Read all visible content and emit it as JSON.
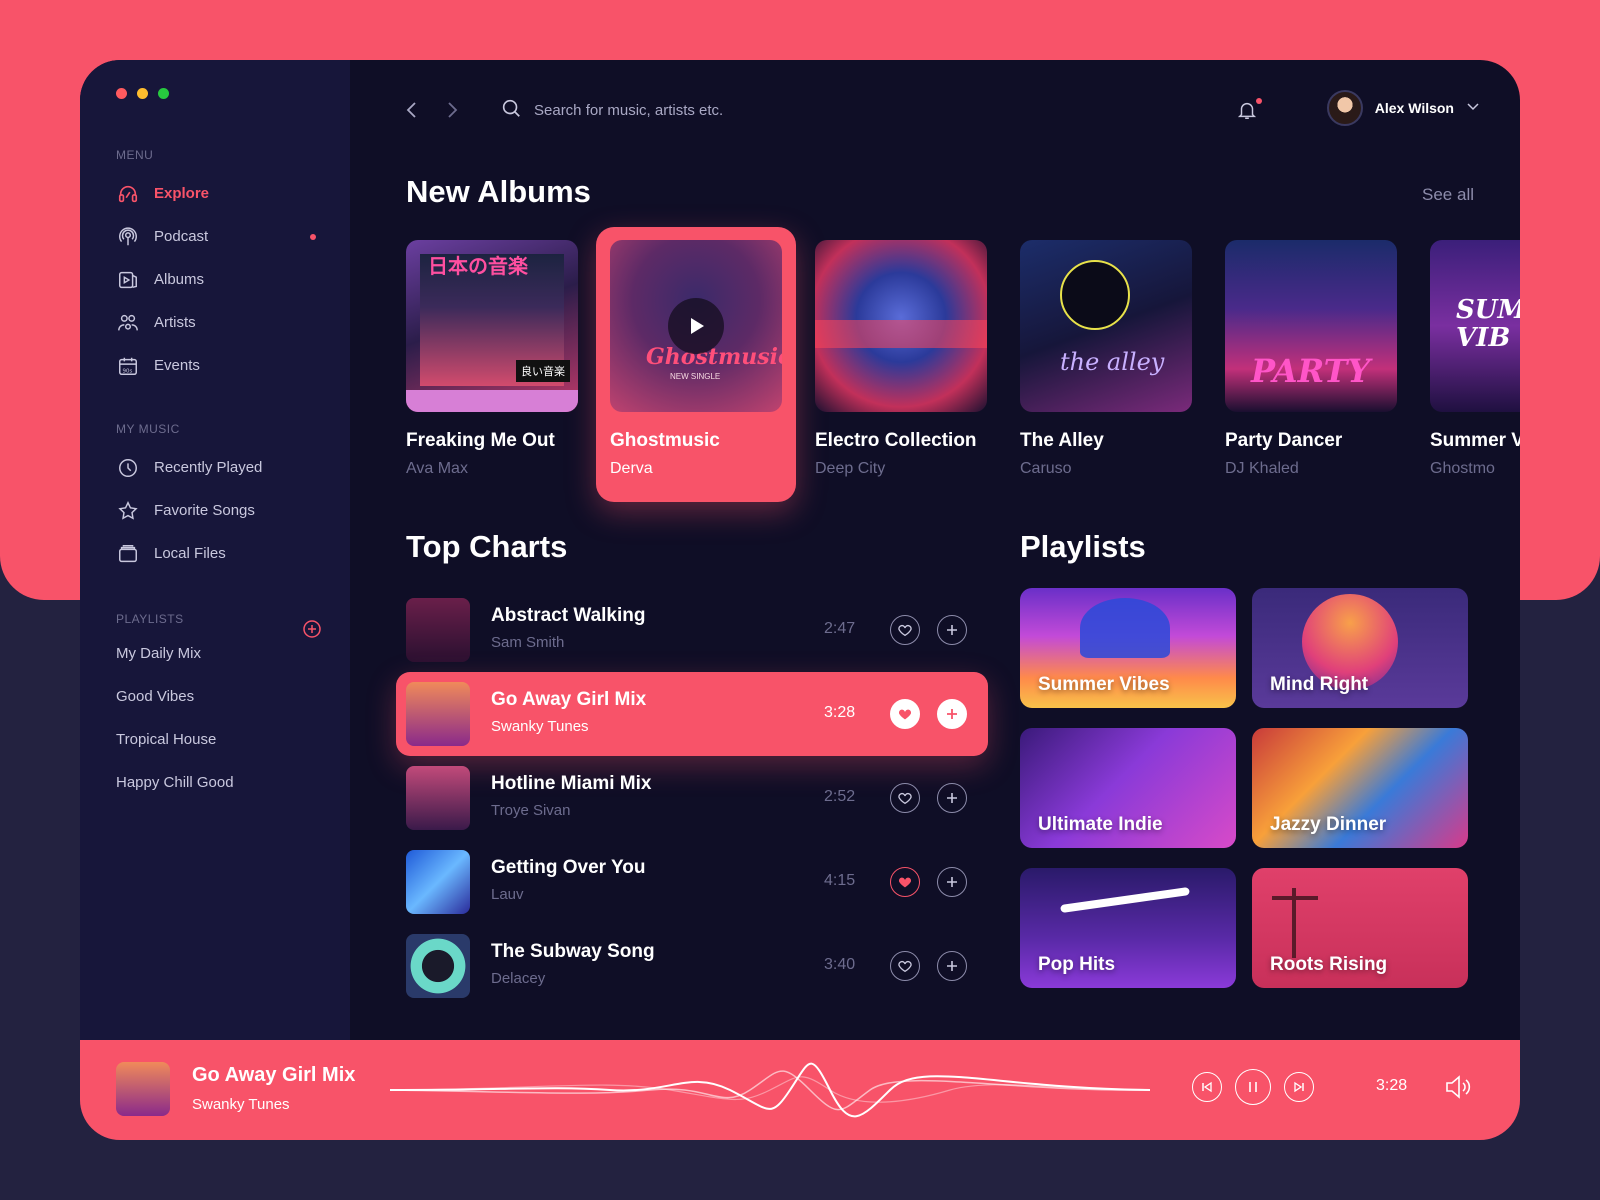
{
  "sidebar": {
    "menu_title": "MENU",
    "menu": [
      {
        "label": "Explore",
        "icon": "explore-icon"
      },
      {
        "label": "Podcast",
        "icon": "podcast-icon"
      },
      {
        "label": "Albums",
        "icon": "albums-icon"
      },
      {
        "label": "Artists",
        "icon": "artists-icon"
      },
      {
        "label": "Events",
        "icon": "events-icon"
      }
    ],
    "my_music_title": "MY MUSIC",
    "my_music": [
      {
        "label": "Recently Played",
        "icon": "clock-icon"
      },
      {
        "label": "Favorite Songs",
        "icon": "star-icon"
      },
      {
        "label": "Local Files",
        "icon": "folder-icon"
      }
    ],
    "playlists_title": "PLAYLISTS",
    "playlists": [
      "My Daily Mix",
      "Good Vibes",
      "Tropical House",
      "Happy Chill Good"
    ]
  },
  "search": {
    "placeholder": "Search for music, artists etc."
  },
  "user": {
    "name": "Alex Wilson"
  },
  "new_albums": {
    "title": "New Albums",
    "see_all": "See all",
    "items": [
      {
        "title": "Freaking Me Out",
        "artist": "Ava Max",
        "cover_text": "日本の音楽",
        "cover_tag": "良い音楽"
      },
      {
        "title": "Ghostmusic",
        "artist": "Derva",
        "cover_text": "Ghostmusic",
        "cover_sub": "NEW SINGLE"
      },
      {
        "title": "Electro Collection",
        "artist": "Deep City"
      },
      {
        "title": "The Alley",
        "artist": "Caruso",
        "cover_text": "the alley"
      },
      {
        "title": "Party Dancer",
        "artist": "DJ Khaled",
        "cover_text": "PARTY"
      },
      {
        "title": "Summer V",
        "artist": "Ghostmo",
        "cover_text": "SUMI VIB"
      }
    ]
  },
  "top_charts": {
    "title": "Top Charts",
    "items": [
      {
        "title": "Abstract Walking",
        "artist": "Sam Smith",
        "duration": "2:47",
        "liked": false
      },
      {
        "title": "Go Away Girl Mix",
        "artist": "Swanky Tunes",
        "duration": "3:28",
        "liked": true
      },
      {
        "title": "Hotline Miami Mix",
        "artist": "Troye Sivan",
        "duration": "2:52",
        "liked": false
      },
      {
        "title": "Getting Over You",
        "artist": "Lauv",
        "duration": "4:15",
        "liked": true
      },
      {
        "title": "The Subway Song",
        "artist": "Delacey",
        "duration": "3:40",
        "liked": false
      }
    ]
  },
  "playlists": {
    "title": "Playlists",
    "items": [
      "Summer Vibes",
      "Mind Right",
      "Ultimate Indie",
      "Jazzy Dinner",
      "Pop Hits",
      "Roots Rising"
    ]
  },
  "player": {
    "title": "Go Away Girl Mix",
    "artist": "Swanky Tunes",
    "time": "3:28"
  },
  "colors": {
    "accent": "#f85369",
    "background": "#0f0e26",
    "sidebar": "#17163a",
    "muted_text": "#6d6c8e"
  }
}
